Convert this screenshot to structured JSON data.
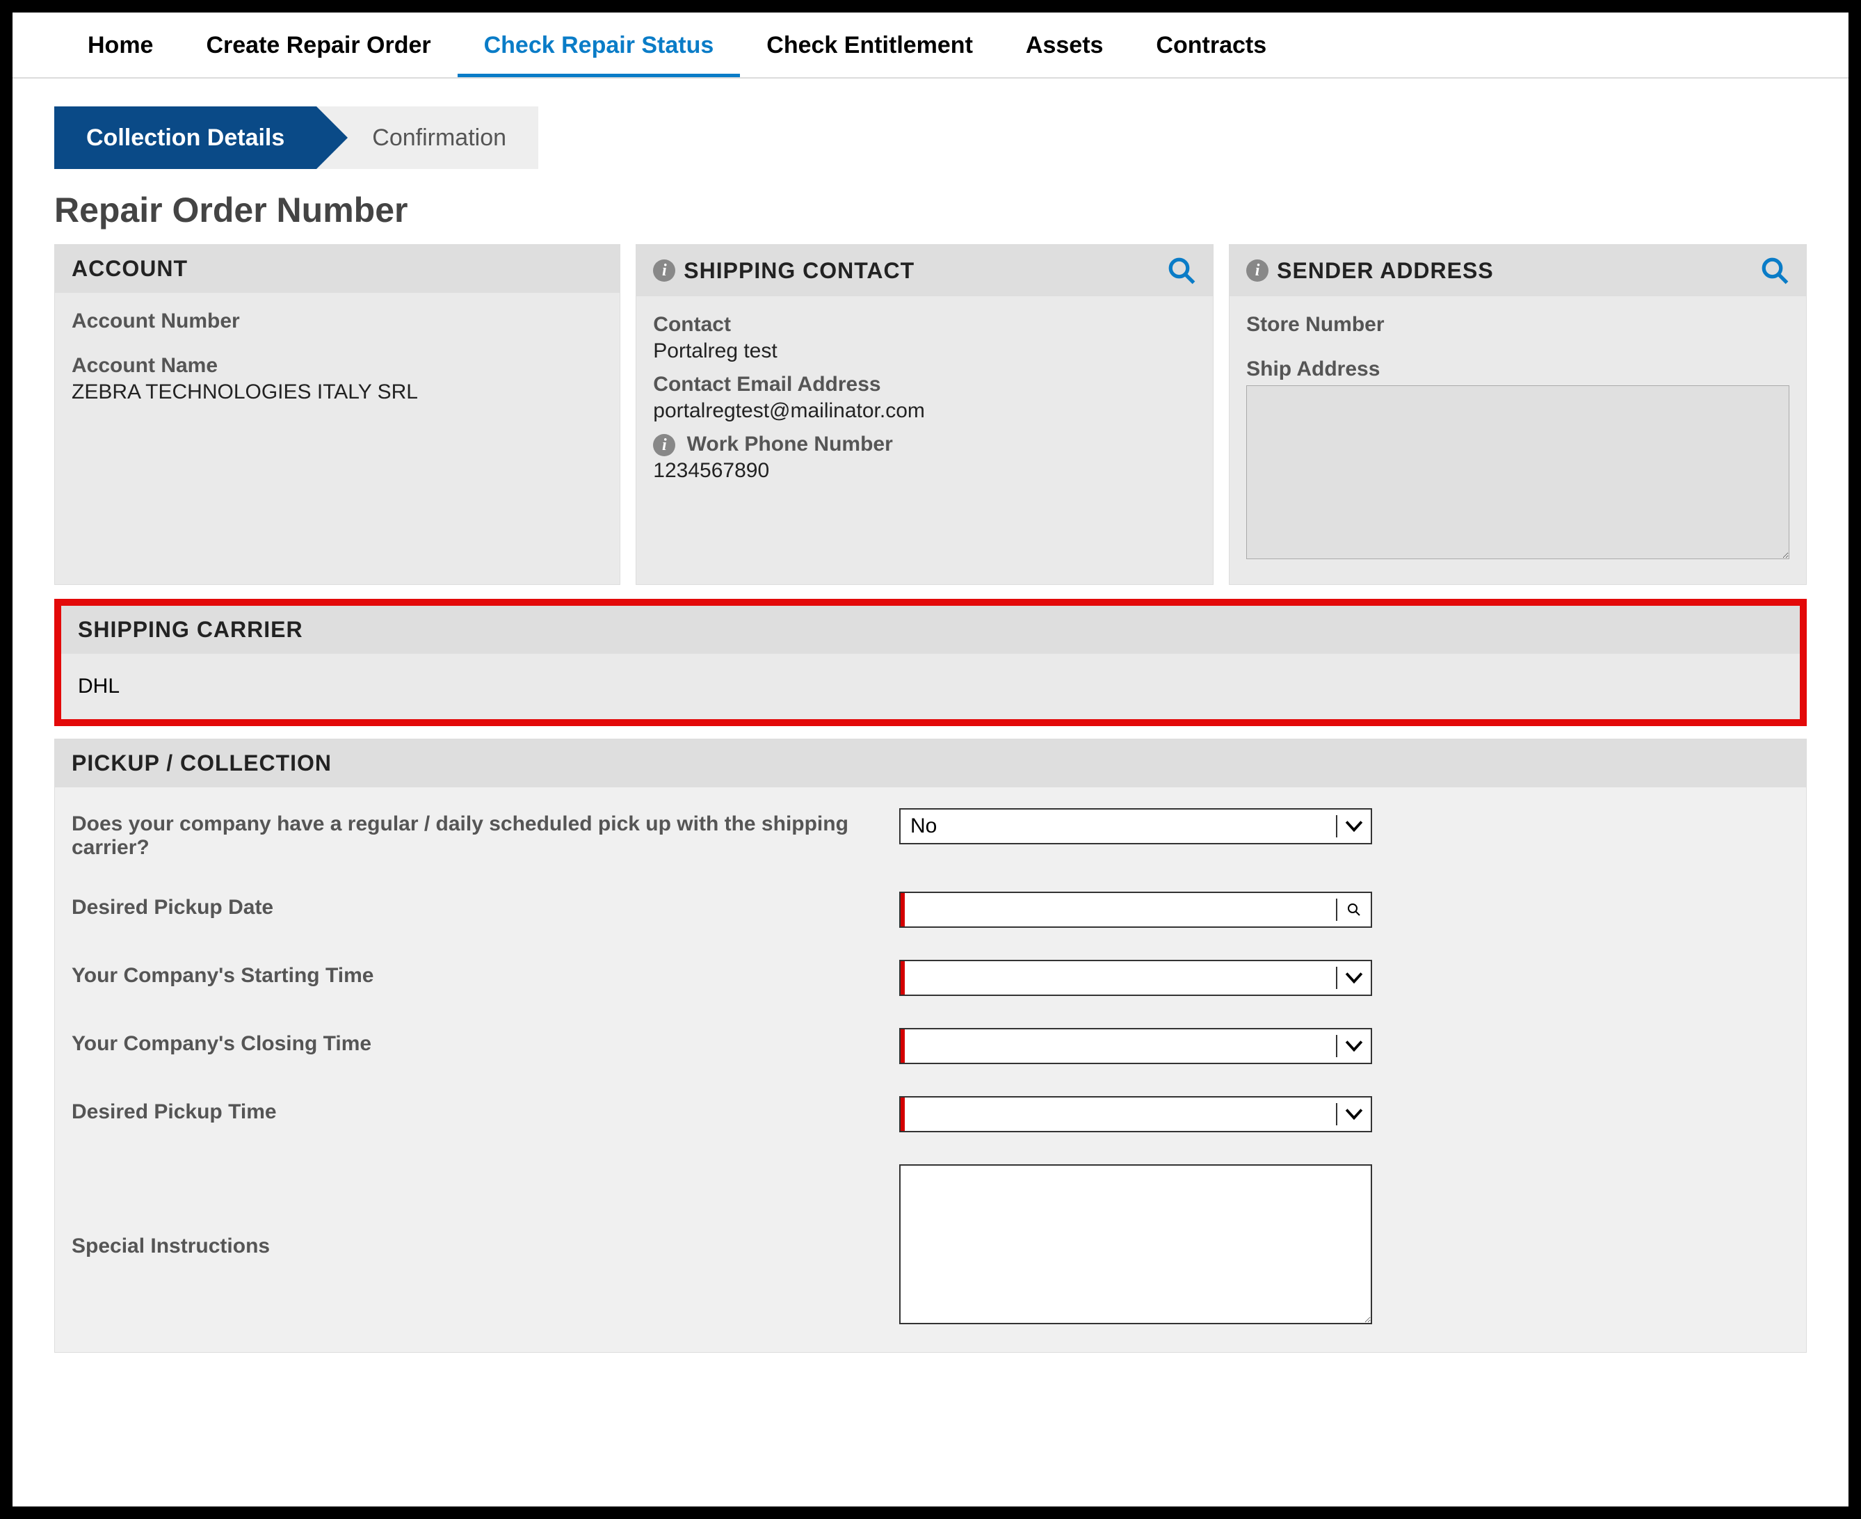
{
  "nav": {
    "items": [
      "Home",
      "Create Repair Order",
      "Check Repair Status",
      "Check Entitlement",
      "Assets",
      "Contracts"
    ],
    "active": "Check Repair Status"
  },
  "progress": {
    "step1": "Collection Details",
    "step2": "Confirmation"
  },
  "page_title": "Repair Order Number",
  "account": {
    "title": "ACCOUNT",
    "number_label": "Account Number",
    "number_value": "",
    "name_label": "Account Name",
    "name_value": "ZEBRA TECHNOLOGIES ITALY SRL"
  },
  "shipping_contact": {
    "title": "SHIPPING CONTACT",
    "contact_label": "Contact",
    "contact_value": "Portalreg test",
    "email_label": "Contact Email Address",
    "email_value": "portalregtest@mailinator.com",
    "phone_label": "Work Phone Number",
    "phone_value": "1234567890"
  },
  "sender_address": {
    "title": "SENDER ADDRESS",
    "store_label": "Store Number",
    "store_value": "",
    "ship_label": "Ship Address",
    "ship_value": ""
  },
  "shipping_carrier": {
    "title": "SHIPPING CARRIER",
    "value": "DHL"
  },
  "pickup": {
    "title": "PICKUP / COLLECTION",
    "q_regular_pickup": "Does your company have a regular / daily scheduled pick up with the shipping carrier?",
    "regular_pickup_value": "No",
    "desired_date_label": "Desired Pickup Date",
    "desired_date_value": "",
    "start_time_label": "Your Company's Starting Time",
    "start_time_value": "",
    "close_time_label": "Your Company's Closing Time",
    "close_time_value": "",
    "desired_time_label": "Desired Pickup Time",
    "desired_time_value": "",
    "special_label": "Special Instructions",
    "special_value": ""
  }
}
